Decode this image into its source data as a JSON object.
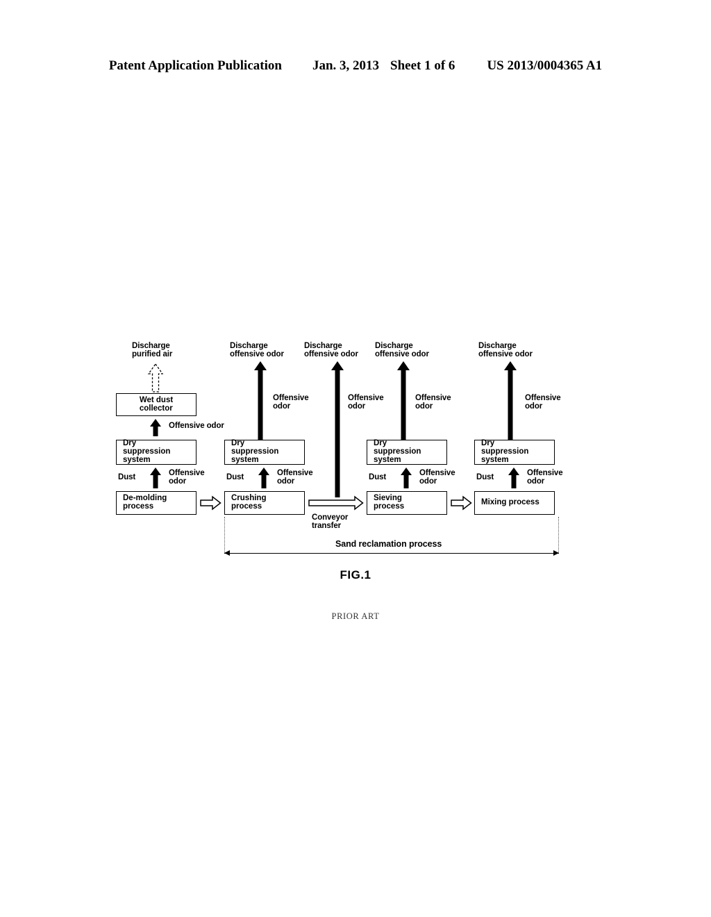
{
  "header": {
    "publication": "Patent Application Publication",
    "date": "Jan. 3, 2013",
    "sheet": "Sheet 1 of 6",
    "patent_number": "US 2013/0004365 A1"
  },
  "figure": {
    "caption": "FIG.1",
    "prior_art": "PRIOR ART",
    "discharge_purified_air": "Discharge\npurified air",
    "discharge_offensive_odor_1": "Discharge\noffensive odor",
    "discharge_offensive_odor_2": "Discharge\noffensive odor",
    "discharge_offensive_odor_3": "Discharge\noffensive odor",
    "discharge_offensive_odor_4": "Discharge\noffensive odor",
    "wet_dust_collector": "Wet dust\ncollector",
    "dry_suppression_system_1": "Dry\nsuppression\nsystem",
    "dry_suppression_system_2": "Dry\nsuppression\nsystem",
    "dry_suppression_system_3": "Dry\nsuppression\nsystem",
    "dry_suppression_system_4": "Dry\nsuppression\nsystem",
    "de_molding_process": "De-molding\nprocess",
    "crushing_process": "Crushing\nprocess",
    "sieving_process": "Sieving\nprocess",
    "mixing_process": "Mixing process",
    "offensive_odor_inline": "Offensive odor",
    "offensive_odor_tall_1": "Offensive\nodor",
    "offensive_odor_tall_2": "Offensive\nodor",
    "offensive_odor_tall_3": "Offensive\nodor",
    "offensive_odor_tall_4": "Offensive\nodor",
    "offensive_odor_short_1": "Offensive\nodor",
    "offensive_odor_short_2": "Offensive\nodor",
    "offensive_odor_short_3": "Offensive\nodor",
    "offensive_odor_short_4": "Offensive\nodor",
    "dust_1": "Dust",
    "dust_2": "Dust",
    "dust_3": "Dust",
    "dust_4": "Dust",
    "conveyor_transfer": "Conveyor\ntransfer",
    "sand_reclamation_process": "Sand reclamation process"
  },
  "colors": {
    "ink": "#000000",
    "paper": "#ffffff",
    "bracket_guide": "#555555"
  }
}
